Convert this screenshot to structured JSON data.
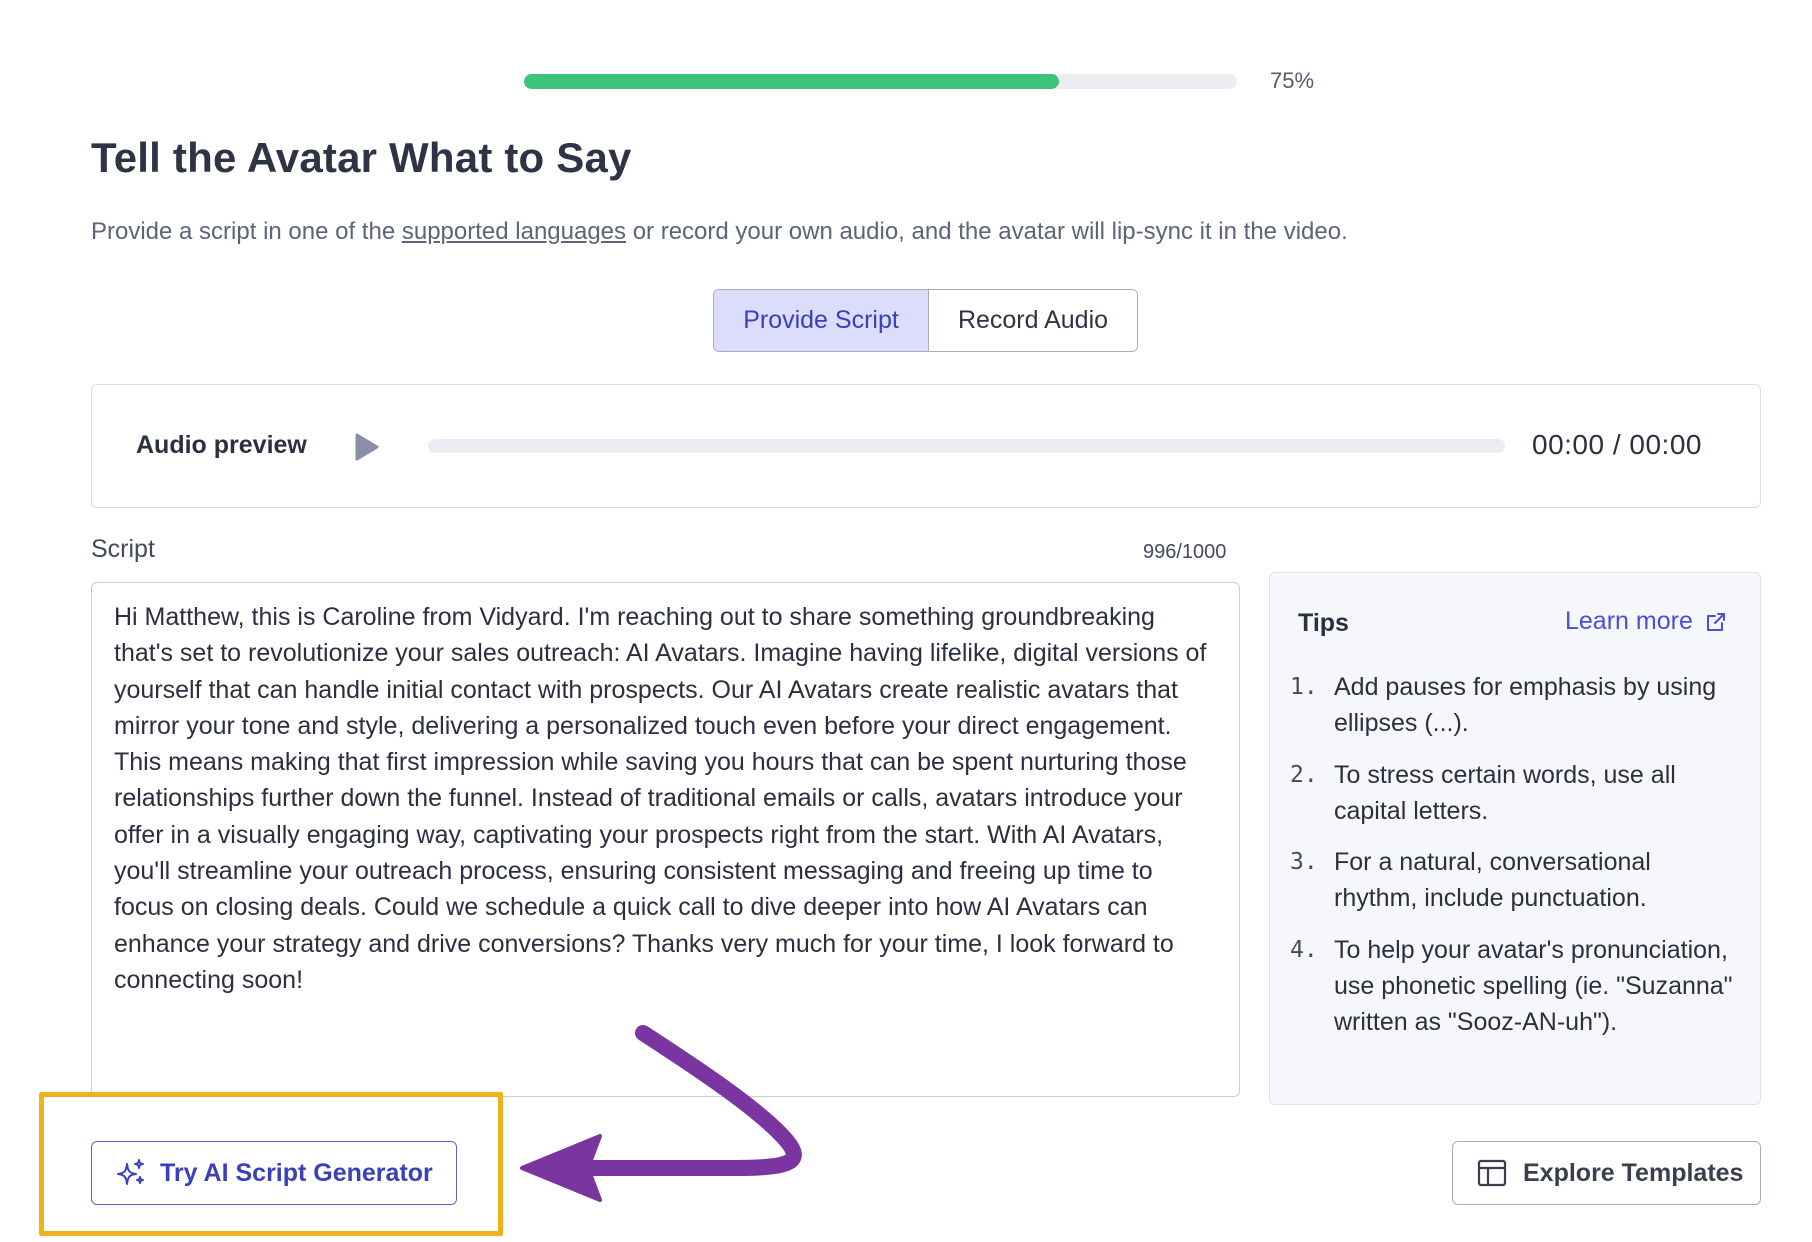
{
  "progress": {
    "percent": 75,
    "label": "75%"
  },
  "header": {
    "title": "Tell the Avatar What to Say",
    "subtitle_before": "Provide a script in one of the ",
    "subtitle_link": "supported languages",
    "subtitle_after": " or record your own audio, and the avatar will lip-sync it in the video."
  },
  "mode_tabs": [
    {
      "label": "Provide Script",
      "selected": true
    },
    {
      "label": "Record Audio",
      "selected": false
    }
  ],
  "audio_preview": {
    "label": "Audio preview",
    "time": "00:00 / 00:00"
  },
  "script": {
    "label": "Script",
    "char_count": "996/1000",
    "text": "Hi Matthew, this is Caroline from Vidyard. I'm reaching out to share something groundbreaking that's set to revolutionize your sales outreach: AI Avatars. Imagine having lifelike, digital versions of yourself that can handle initial contact with prospects. Our AI Avatars create realistic avatars that mirror your tone and style, delivering a personalized touch even before your direct engagement. This means making that first impression while saving you hours that can be spent nurturing those relationships further down the funnel. Instead of traditional emails or calls, avatars introduce your offer in a visually engaging way, captivating your prospects right from the start. With AI Avatars, you'll streamline your outreach process, ensuring consistent messaging and freeing up time to focus on closing deals. Could we schedule a quick call to dive deeper into how AI Avatars can enhance your strategy and drive conversions? Thanks very much for your time, I look forward to connecting soon!"
  },
  "tips": {
    "title": "Tips",
    "learn_more": "Learn more",
    "items": [
      {
        "num": "1.",
        "text": "Add pauses for emphasis by using ellipses (...)."
      },
      {
        "num": "2.",
        "text": "To stress certain words, use all capital letters."
      },
      {
        "num": "3.",
        "text": "For a natural, conversational rhythm, include punctuation."
      },
      {
        "num": "4.",
        "text": "To help your avatar's pronunciation, use phonetic spelling (ie. \"Suzanna\" written as \"Sooz-AN-uh\")."
      }
    ]
  },
  "buttons": {
    "ai_generator": "Try AI Script Generator",
    "explore_templates": "Explore Templates"
  },
  "colors": {
    "progress": "#3ec47a",
    "accent": "#4a4fd4",
    "highlight": "#f2b01e",
    "annotation_arrow": "#7a35a0"
  },
  "icons": {
    "play": "play-icon",
    "external_link": "external-link-icon",
    "sparkle": "sparkle-icon",
    "template": "template-icon"
  }
}
